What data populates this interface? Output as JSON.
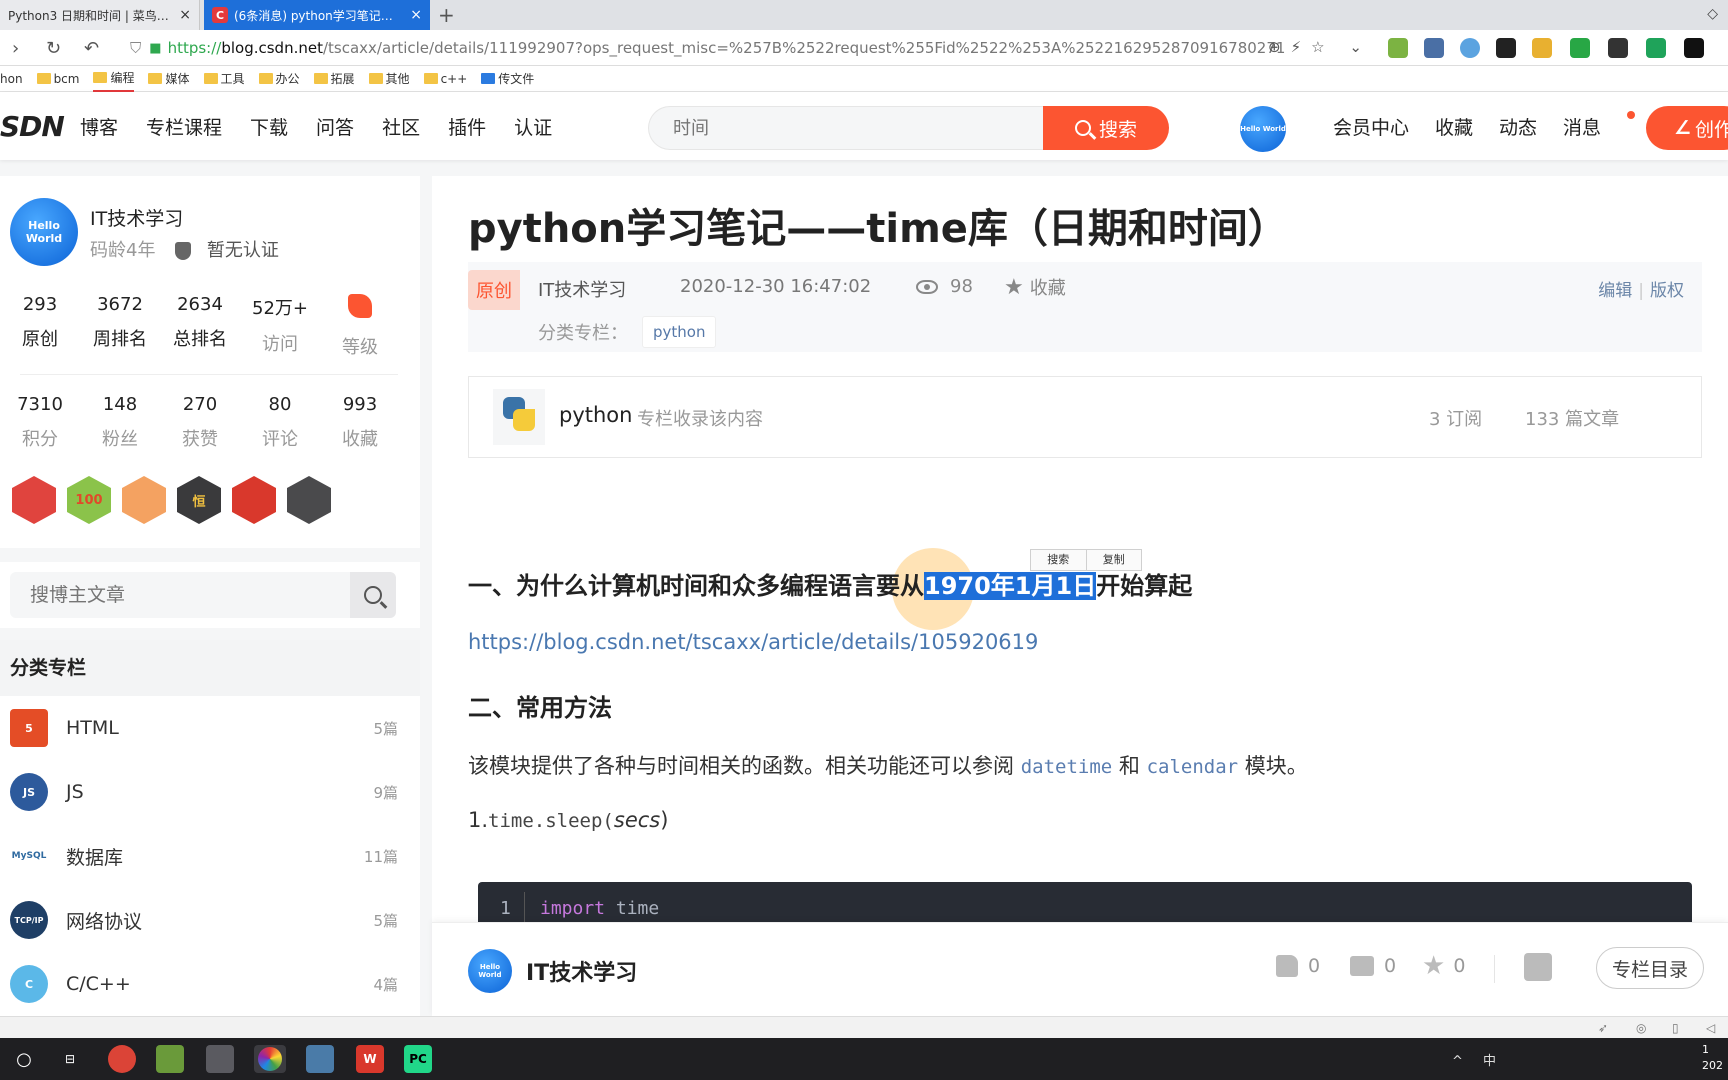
{
  "browser": {
    "tabs": [
      {
        "title": "Python3 日期和时间 | 菜鸟教程",
        "close": "×"
      },
      {
        "favicon": "C",
        "title": "(6条消息) python学习笔记——",
        "close": "×"
      }
    ],
    "new_tab": "+",
    "url": {
      "scheme": "https://",
      "host": "blog.csdn.net",
      "rest": "/tscaxx/article/details/111992907?ops_request_misc=%257B%2522request%255Fid%2522%253A%2522162952870916780271"
    },
    "bookmarks": [
      "hon",
      "bcm",
      "编程",
      "媒体",
      "工具",
      "办公",
      "拓展",
      "其他",
      "c++",
      "传文件"
    ]
  },
  "header": {
    "logo": "SDN",
    "nav": [
      "博客",
      "专栏课程",
      "下载",
      "问答",
      "社区",
      "插件",
      "认证"
    ],
    "search_placeholder": "时间",
    "search_button": "搜索",
    "avatar_text": "Hello World",
    "user_nav": [
      "会员中心",
      "收藏",
      "动态",
      "消息"
    ],
    "create_button": "创作"
  },
  "profile": {
    "avatar_text": "Hello World",
    "name": "IT技术学习",
    "age": "码龄4年",
    "cert": "暂无认证",
    "stats_row1": [
      {
        "num": "293",
        "label": "原创"
      },
      {
        "num": "3672",
        "label": "周排名"
      },
      {
        "num": "2634",
        "label": "总排名"
      },
      {
        "num": "52万+",
        "label": "访问"
      },
      {
        "num": "",
        "label": "等级"
      }
    ],
    "stats_row2": [
      {
        "num": "7310",
        "label": "积分"
      },
      {
        "num": "148",
        "label": "粉丝"
      },
      {
        "num": "270",
        "label": "获赞"
      },
      {
        "num": "80",
        "label": "评论"
      },
      {
        "num": "993",
        "label": "收藏"
      }
    ],
    "badges": [
      "",
      "100",
      "",
      "恒",
      "",
      ""
    ]
  },
  "blog_search_placeholder": "搜博主文章",
  "categories": {
    "title": "分类专栏",
    "items": [
      {
        "name": "HTML",
        "count": "5篇",
        "icon": "5"
      },
      {
        "name": "JS",
        "count": "9篇",
        "icon": "JS"
      },
      {
        "name": "数据库",
        "count": "11篇",
        "icon": "MySQL"
      },
      {
        "name": "网络协议",
        "count": "5篇",
        "icon": "TCP/IP"
      },
      {
        "name": "C/C++",
        "count": "4篇",
        "icon": "C"
      }
    ]
  },
  "article": {
    "title": "python学习笔记——time库（日期和时间）",
    "original_tag": "原创",
    "author": "IT技术学习",
    "time": "2020-12-30 16:47:02",
    "views": "98",
    "fav": "收藏",
    "edit": "编辑",
    "copyright": "版权",
    "category_label": "分类专栏：",
    "category_tag": "python",
    "column": {
      "name": "python",
      "desc": "专栏收录该内容",
      "subs": "3 订阅",
      "count": "133 篇文章"
    },
    "h1_before": "一、为什么计算机时间和众多编程语言要从",
    "h1_selected": "1970年1月1日",
    "h1_after": "开始算起",
    "popup_search": "搜索",
    "popup_copy": "复制",
    "link": "https://blog.csdn.net/tscaxx/article/details/105920619",
    "h2": "二、常用方法",
    "para_a": "该模块提供了各种与时间相关的函数。相关功能还可以参阅 ",
    "para_code1": "datetime",
    "para_b": " 和 ",
    "para_code2": "calendar",
    "para_c": " 模块。",
    "item1_num": "1.",
    "item1_code": "time.sleep(",
    "item1_arg": "secs",
    "item1_close": ")",
    "code": {
      "line_no": "1",
      "kw": "import",
      "rest": " time"
    }
  },
  "bottombar": {
    "avatar_text": "Hello World",
    "name": "IT技术学习",
    "likes": "0",
    "comments": "0",
    "favs": "0",
    "column_dir": "专栏目录"
  },
  "taskbar": {
    "tray": "^ 中",
    "clock_line1": "1",
    "clock_line2": "202"
  }
}
